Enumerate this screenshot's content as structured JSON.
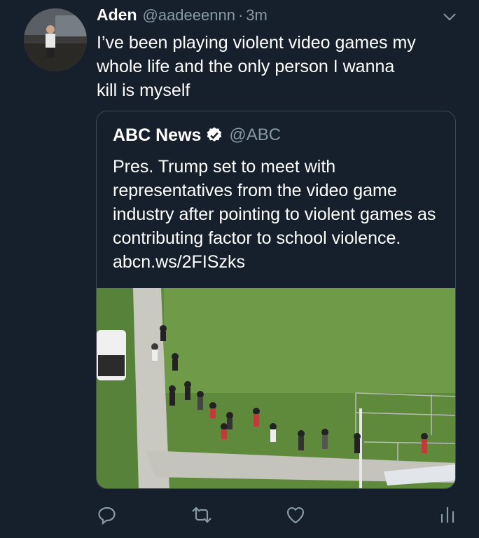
{
  "tweet": {
    "author_name": "Aden",
    "author_handle": "@aadeeennn",
    "separator": "·",
    "time": "3m",
    "text": "I’ve been playing violent video games my\nwhole life and the only person I wanna\nkill is myself"
  },
  "quoted_tweet": {
    "author_name": "ABC News",
    "author_handle": "@ABC",
    "verified": true,
    "text": "Pres. Trump set to meet with representatives from the video game industry after pointing to violent games as contributing factor to school violence. abcn.ws/2FISzks"
  },
  "icons": {
    "menu": "chevron-down-icon",
    "reply": "reply-icon",
    "retweet": "retweet-icon",
    "like": "heart-icon",
    "analytics": "analytics-icon",
    "verified": "verified-badge-icon"
  },
  "colors": {
    "background": "#16202c",
    "secondary_text": "#8899a6",
    "verified_badge": "#ffffff"
  }
}
